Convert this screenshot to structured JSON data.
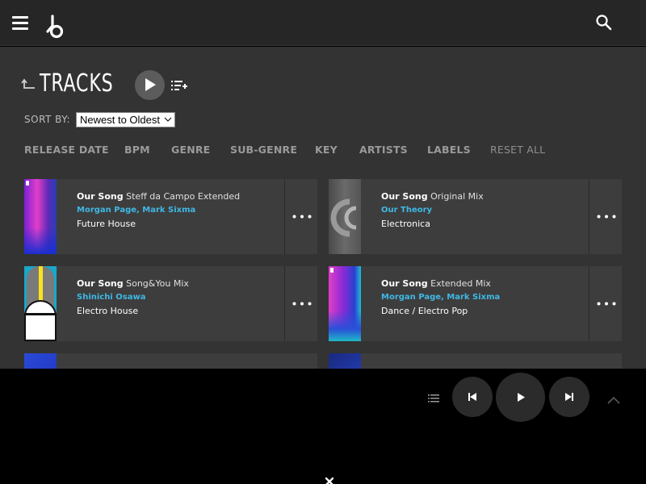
{
  "header": {
    "menu_icon": "hamburger-menu-icon",
    "logo_icon": "beatport-logo-icon",
    "search_icon": "search-icon"
  },
  "page": {
    "title": "TRACKS",
    "back_icon": "back-arrow-icon",
    "play_icon": "play-icon",
    "queue_icon": "add-to-queue-icon"
  },
  "sort": {
    "label": "SORT BY:",
    "selected": "Newest to Oldest"
  },
  "filters": {
    "release_date": "RELEASE DATE",
    "bpm": "BPM",
    "genre": "GENRE",
    "sub_genre": "SUB-GENRE",
    "key": "KEY",
    "artists": "ARTISTS",
    "labels": "LABELS",
    "reset_all": "RESET ALL"
  },
  "tracks": [
    {
      "name": "Our Song",
      "mix": "Steff da Campo Extended",
      "artists": "Morgan Page, Mark Sixma",
      "genre": "Future House"
    },
    {
      "name": "Our Song",
      "mix": "Original Mix",
      "artists": "Our Theory",
      "genre": "Electronica"
    },
    {
      "name": "Our Song",
      "mix": "Song&You Mix",
      "artists": "Shinichi Osawa",
      "genre": "Electro House"
    },
    {
      "name": "Our Song",
      "mix": "Extended Mix",
      "artists": "Morgan Page, Mark Sixma",
      "genre": "Dance / Electro Pop"
    }
  ],
  "player": {
    "queue_icon": "queue-list-icon",
    "prev_icon": "skip-previous-icon",
    "play_icon": "play-icon",
    "next_icon": "skip-next-icon",
    "collapse_icon": "chevron-up-icon",
    "close_icon": "close-icon"
  },
  "colors": {
    "accent": "#3fb8e6",
    "topbar": "#262626",
    "content_bg": "#333333",
    "card_bg": "#3d3d3d",
    "player_bg": "#000000"
  }
}
